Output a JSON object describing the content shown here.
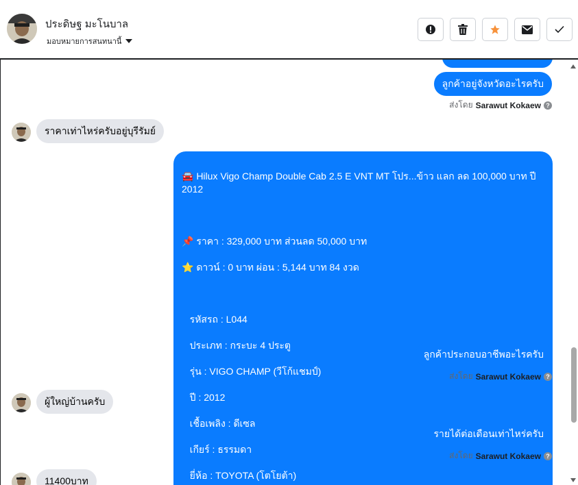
{
  "header": {
    "contact_name": "ประดิษฐ มะโนบาล",
    "assign_label": "มอบหมายการสนทนานี้",
    "actions": [
      {
        "name": "report-button",
        "icon": "alert-icon"
      },
      {
        "name": "delete-button",
        "icon": "trash-icon"
      },
      {
        "name": "star-button",
        "icon": "star-icon"
      },
      {
        "name": "mark-unread-button",
        "icon": "envelope-icon"
      },
      {
        "name": "done-button",
        "icon": "check-icon"
      }
    ]
  },
  "colors": {
    "outgoing_bubble": "#0a7cff",
    "incoming_bubble": "#e4e6eb",
    "star": "#f7923b"
  },
  "messages": {
    "out1": "ลูกค้าอยู่จังหวัดอะไรครับ",
    "out1_sent_prefix": "ส่งโดย",
    "out1_sent_by": "Sarawut Kokaew",
    "in1": "ราคาเท่าไหร่ครับอยู่บุรีรัมย์",
    "listing": {
      "title": "🚘 Hilux Vigo Champ Double Cab 2.5 E VNT MT โปร...ข้าว แลก ลด 100,000 บาท ปี 2012",
      "price": "📌 ราคา : 329,000 บาท ส่วนลด 50,000 บาท",
      "down": "⭐ ดาวน์ : 0 บาท ผ่อน : 5,144 บาท 84 งวด",
      "code": "   รหัสรถ : L044",
      "type": "   ประเภท : กระบะ 4 ประตู",
      "model": "   รุ่น : VIGO CHAMP (วีโก้แชมป์)",
      "year": "   ปี : 2012",
      "fuel": "   เชื้อเพลิง : ดีเซล",
      "gear": "   เกียร์ : ธรรมดา",
      "brand": "   ยี่ห้อ : TOYOTA (โตโยต้า)"
    },
    "out2": "ลูกค้าประกอบอาชีพอะไรครับ",
    "out2_sent_prefix": "ส่งโดย",
    "out2_sent_by": "Sarawut Kokaew",
    "in2": "ผู้ใหญ่บ้านครับ",
    "out3": "รายได้ต่อเดือนเท่าไหร่ครับ",
    "out3_sent_prefix": "ส่งโดย",
    "out3_sent_by": "Sarawut Kokaew",
    "in3": "11400บาท"
  }
}
